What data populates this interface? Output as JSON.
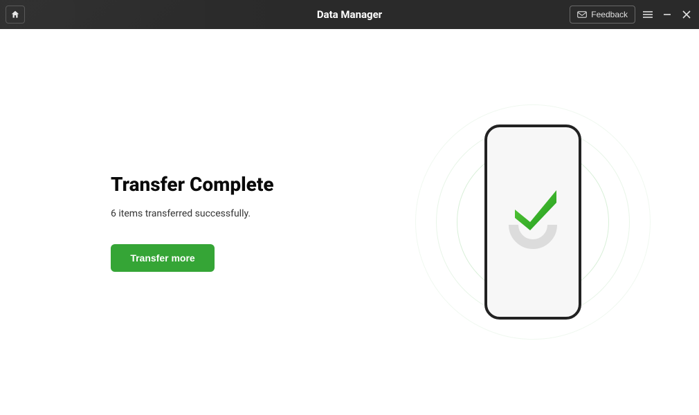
{
  "titlebar": {
    "app_title": "Data Manager",
    "feedback_label": "Feedback"
  },
  "main": {
    "heading": "Transfer Complete",
    "status_text": "6 items transferred successfully.",
    "transfer_more_label": "Transfer more"
  },
  "colors": {
    "accent_green": "#35a536",
    "titlebar_bg": "#2a2a2a"
  }
}
